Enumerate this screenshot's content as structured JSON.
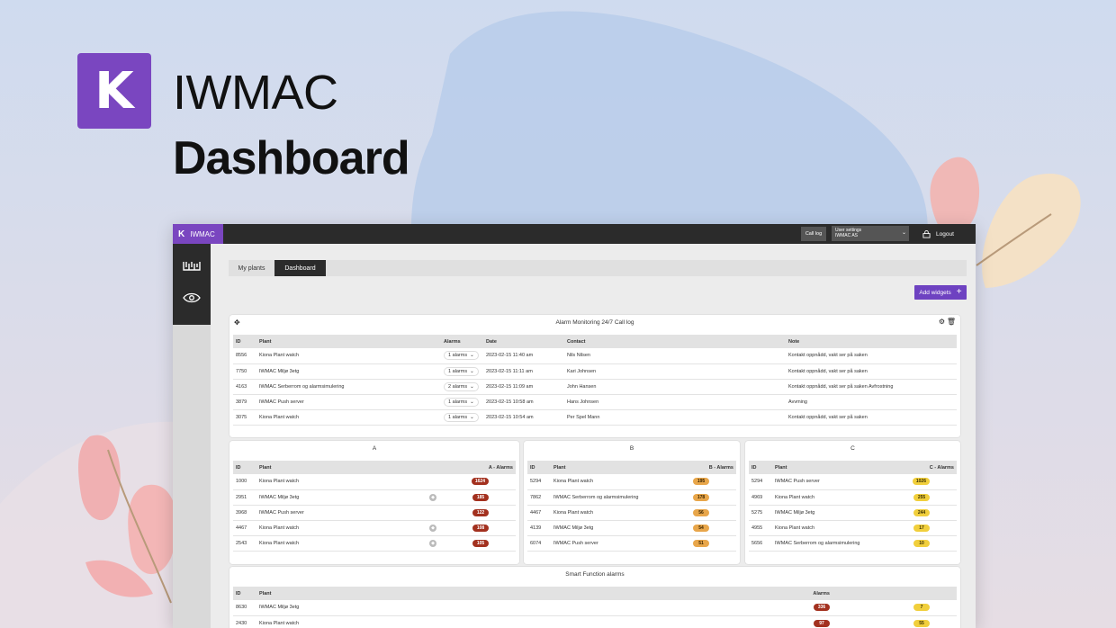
{
  "hero": {
    "logo_letter": "K",
    "brand": "IWMAC",
    "title": "Dashboard",
    "accent": "#7a46c0"
  },
  "topbar": {
    "brand_letter": "K",
    "brand": "IWMAC",
    "call_log": "Call log",
    "user_settings_label": "User settings",
    "user_settings_value": "IWMAC AS",
    "logout": "Logout"
  },
  "sidebar": {
    "items": [
      {
        "icon": "iwmac-logo-icon"
      },
      {
        "icon": "eye-icon"
      }
    ]
  },
  "tabs": [
    {
      "label": "My plants"
    },
    {
      "label": "Dashboard"
    }
  ],
  "add_widgets": "Add widgets",
  "alarm_widget": {
    "title": "Alarm Monitoring 24/7 Call log",
    "columns": [
      "ID",
      "Plant",
      "Alarms",
      "Date",
      "Contact",
      "Note"
    ],
    "rows": [
      {
        "id": "8556",
        "plant": "Kiona Plant watch",
        "alarms": "1 alarms",
        "date": "2023-02-15 11:40 am",
        "contact": "Nils Nilsen",
        "note": "Kontakt oppnådd, vakt ser på saken"
      },
      {
        "id": "7750",
        "plant": "IWMAC Miljø 3etg",
        "alarms": "1 alarms",
        "date": "2023-02-15 11:11 am",
        "contact": "Kari Johnsen",
        "note": "Kontakt oppnådd, vakt ser på saken"
      },
      {
        "id": "4163",
        "plant": "IWMAC Serberrom og alarmsimulering",
        "alarms": "2 alarms",
        "date": "2023-02-15 11:09 am",
        "contact": "John Hansen",
        "note": "Kontakt oppnådd, vakt ser på saken Avfrostning"
      },
      {
        "id": "3879",
        "plant": "IWMAC Push server",
        "alarms": "1 alarms",
        "date": "2023-02-15 10:58 am",
        "contact": "Hans Johnsen",
        "note": "Avvming"
      },
      {
        "id": "3075",
        "plant": "Kiona Plant watch",
        "alarms": "1 alarms",
        "date": "2023-02-15 10:54 am",
        "contact": "Per Spel Mann",
        "note": "Kontakt oppnådd, vakt ser på saken"
      }
    ]
  },
  "widget_a": {
    "title": "A",
    "columns": [
      "ID",
      "Plant",
      "A - Alarms"
    ],
    "rows": [
      {
        "id": "1000",
        "plant": "Kiona Plant watch",
        "shield": false,
        "value": "1624"
      },
      {
        "id": "2951",
        "plant": "IWMAC Miljø 3etg",
        "shield": true,
        "value": "185"
      },
      {
        "id": "3968",
        "plant": "IWMAC Push server",
        "shield": false,
        "value": "122"
      },
      {
        "id": "4467",
        "plant": "Kiona Plant watch",
        "shield": true,
        "value": "108"
      },
      {
        "id": "2543",
        "plant": "Kiona Plant watch",
        "shield": true,
        "value": "105"
      }
    ]
  },
  "widget_b": {
    "title": "B",
    "columns": [
      "ID",
      "Plant",
      "B - Alarms"
    ],
    "rows": [
      {
        "id": "5294",
        "plant": "Kiona Plant watch",
        "value": "195"
      },
      {
        "id": "7862",
        "plant": "IWMAC Serberrom og alarmsimulering",
        "value": "178"
      },
      {
        "id": "4467",
        "plant": "Kiona Plant watch",
        "value": "56"
      },
      {
        "id": "4139",
        "plant": "IWMAC Miljø 3etg",
        "value": "54"
      },
      {
        "id": "6074",
        "plant": "IWMAC Push server",
        "value": "51"
      }
    ]
  },
  "widget_c": {
    "title": "C",
    "columns": [
      "ID",
      "Plant",
      "C - Alarms"
    ],
    "rows": [
      {
        "id": "5294",
        "plant": "IWMAC Push server",
        "value": "1026"
      },
      {
        "id": "4969",
        "plant": "Kiona Plant watch",
        "value": "255"
      },
      {
        "id": "5275",
        "plant": "IWMAC Miljø 3etg",
        "value": "244"
      },
      {
        "id": "4955",
        "plant": "Kiona Plant watch",
        "value": "17"
      },
      {
        "id": "5656",
        "plant": "IWMAC Serberrom og alarmsimulering",
        "value": "10"
      }
    ]
  },
  "smart_widget": {
    "title": "Smart Function alarms",
    "columns": [
      "ID",
      "Plant",
      "Alarms"
    ],
    "rows": [
      {
        "id": "8630",
        "plant": "IWMAC Miljø 3etg",
        "red": "336",
        "yellow": "7"
      },
      {
        "id": "2430",
        "plant": "Kiona Plant watch",
        "red": "97",
        "yellow": "55"
      }
    ]
  },
  "colors": {
    "accent": "#6e42c1",
    "red_pill": "#a3311f",
    "orange_pill": "#e8a64a",
    "yellow_pill": "#f1cf3c",
    "dark_bar": "#2b2b2b"
  }
}
